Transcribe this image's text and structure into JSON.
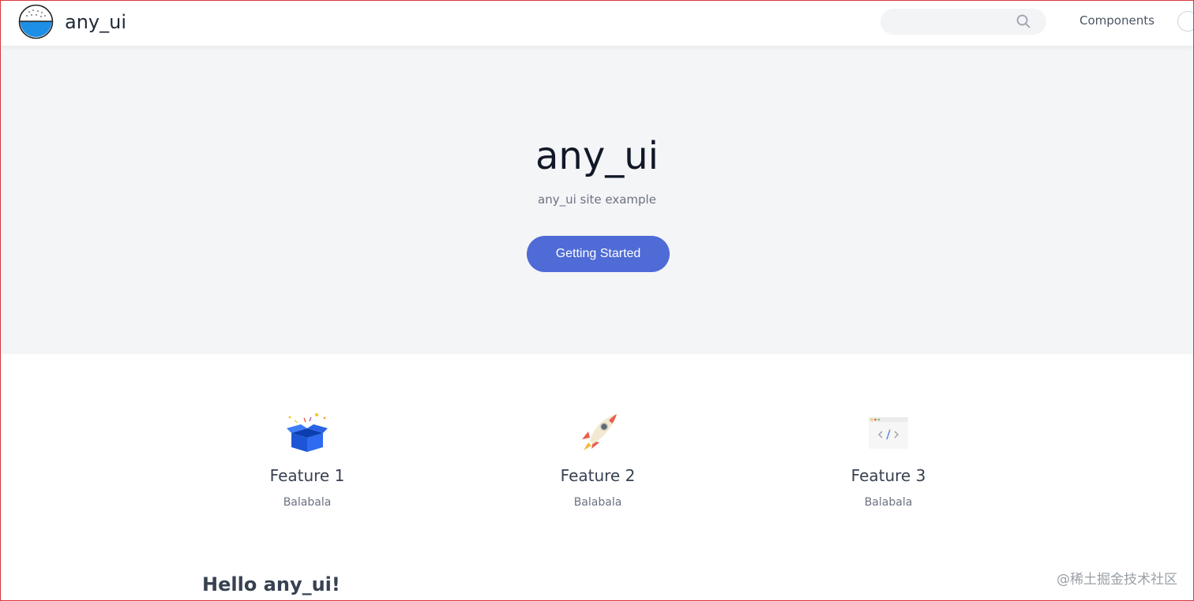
{
  "navbar": {
    "brand_title": "any_ui",
    "search": {
      "value": "",
      "placeholder": ""
    },
    "links": [
      {
        "label": "Components"
      }
    ]
  },
  "hero": {
    "title": "any_ui",
    "subtitle": "any_ui site example",
    "cta_label": "Getting Started"
  },
  "features": [
    {
      "icon": "gift-box-icon",
      "title": "Feature 1",
      "description": "Balabala"
    },
    {
      "icon": "rocket-icon",
      "title": "Feature 2",
      "description": "Balabala"
    },
    {
      "icon": "code-window-icon",
      "title": "Feature 3",
      "description": "Balabala"
    }
  ],
  "content": {
    "heading": "Hello any_ui!"
  },
  "watermark": "@稀土掘金技术社区",
  "colors": {
    "accent": "#4e6bd6",
    "hero_bg": "#f4f5f7",
    "logo_blue": "#1e8fe6"
  }
}
